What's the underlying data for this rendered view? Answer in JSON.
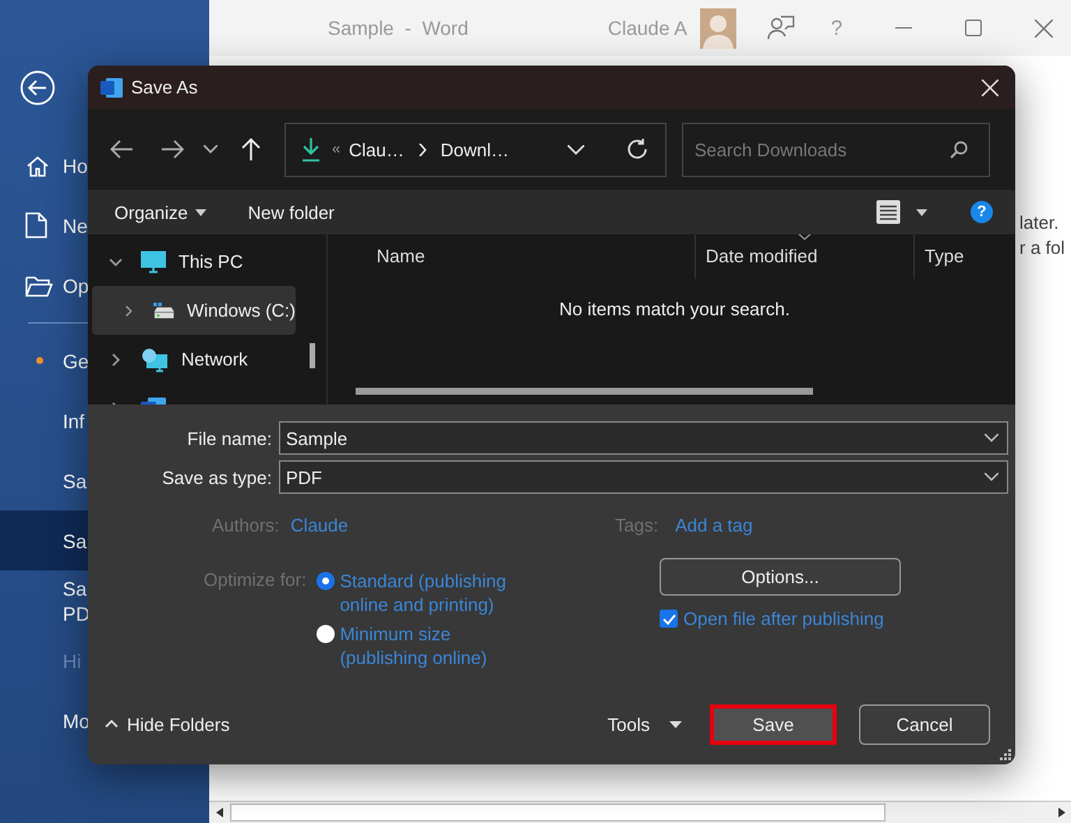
{
  "word_window": {
    "title": "Sample  -  Word",
    "user": "Claude A",
    "help": "?",
    "backstage_items": [
      {
        "label": "Ho",
        "kind": "home",
        "selected": false,
        "disabled": false
      },
      {
        "label": "Ne",
        "kind": "new",
        "selected": false,
        "disabled": false
      },
      {
        "label": "Op",
        "kind": "open",
        "selected": false,
        "disabled": false
      },
      {
        "label": "Ge",
        "kind": "dot",
        "selected": false,
        "disabled": false
      },
      {
        "label": "Inf",
        "kind": "plain",
        "selected": false,
        "disabled": false
      },
      {
        "label": "Sa",
        "kind": "plain",
        "selected": false,
        "disabled": false
      },
      {
        "label": "Sa",
        "kind": "plain",
        "selected": true,
        "disabled": false
      },
      {
        "label": "Sa\nPD",
        "kind": "plain",
        "selected": false,
        "disabled": false
      },
      {
        "label": "Hi",
        "kind": "plain",
        "selected": false,
        "disabled": true
      },
      {
        "label": "Mo",
        "kind": "plain",
        "selected": false,
        "disabled": false
      }
    ],
    "document_text": [
      "later.",
      "r a fol"
    ]
  },
  "dialog": {
    "title": "Save As",
    "address": {
      "parts": [
        "«",
        "Clau…",
        "Downl…"
      ]
    },
    "search": {
      "placeholder": "Search Downloads"
    },
    "commands": [
      "Organize",
      "New folder"
    ],
    "help": "?",
    "tree": [
      {
        "label": "This PC",
        "kind": "pc",
        "expanded": true,
        "selected": false,
        "children": [
          {
            "label": "Windows (C:)",
            "kind": "drive",
            "expanded": false,
            "selected": true
          }
        ]
      },
      {
        "label": "Network",
        "kind": "network",
        "expanded": false,
        "selected": false
      },
      {
        "kind": "app",
        "expanded": false,
        "selected": false
      }
    ],
    "columns": [
      {
        "label": "Name",
        "sorted": false
      },
      {
        "label": "Date modified",
        "sorted": true
      },
      {
        "label": "Type",
        "sorted": false
      }
    ],
    "empty_message": "No items match your search.",
    "file_name": {
      "label": "File name:",
      "value": "Sample"
    },
    "save_type": {
      "label": "Save as type:",
      "value": "PDF"
    },
    "authors": {
      "label": "Authors:",
      "value": "Claude"
    },
    "tags": {
      "label": "Tags:",
      "value": "Add a tag"
    },
    "optimize": {
      "label": "Optimize for:",
      "options": [
        {
          "label": "Standard (publishing online and printing)",
          "selected": true
        },
        {
          "label": "Minimum size (publishing online)",
          "selected": false
        }
      ]
    },
    "options_button": "Options...",
    "open_after": {
      "label": "Open file after publishing",
      "checked": true
    },
    "hide_folders": "Hide Folders",
    "tools": "Tools",
    "buttons": [
      {
        "label": "Save",
        "highlighted": true
      },
      {
        "label": "Cancel",
        "highlighted": false
      }
    ]
  }
}
